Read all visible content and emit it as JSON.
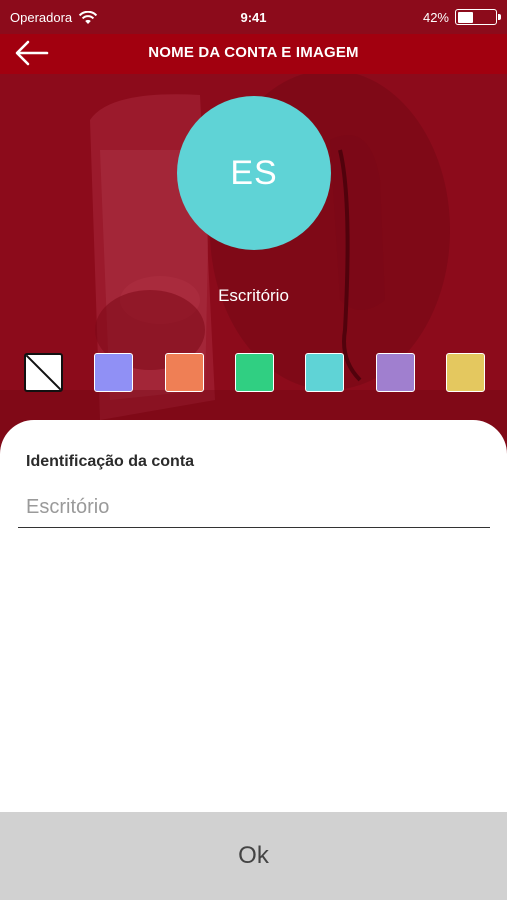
{
  "status_bar": {
    "carrier": "Operadora",
    "time": "9:41",
    "battery_percent": "42%",
    "battery_level": 0.42
  },
  "header": {
    "title": "NOME DA CONTA E IMAGEM",
    "back_icon": "arrow-left-icon"
  },
  "avatar": {
    "initials": "ES",
    "color": "#5fd3d6"
  },
  "account": {
    "name": "Escritório"
  },
  "swatches": [
    {
      "name": "none",
      "color": "#ffffff"
    },
    {
      "name": "periwinkle",
      "color": "#9090f5"
    },
    {
      "name": "coral",
      "color": "#ef7f55"
    },
    {
      "name": "green",
      "color": "#30cf82"
    },
    {
      "name": "turquoise",
      "color": "#5fd3d6"
    },
    {
      "name": "lavender",
      "color": "#a07fcf"
    },
    {
      "name": "mustard",
      "color": "#e4c85f"
    }
  ],
  "form": {
    "label": "Identificação da conta",
    "placeholder": "Escritório",
    "value": ""
  },
  "footer": {
    "ok_label": "Ok"
  },
  "colors": {
    "brand": "#a2000f",
    "hero": "#8a0a1a",
    "footer": "#d1d1d1"
  }
}
